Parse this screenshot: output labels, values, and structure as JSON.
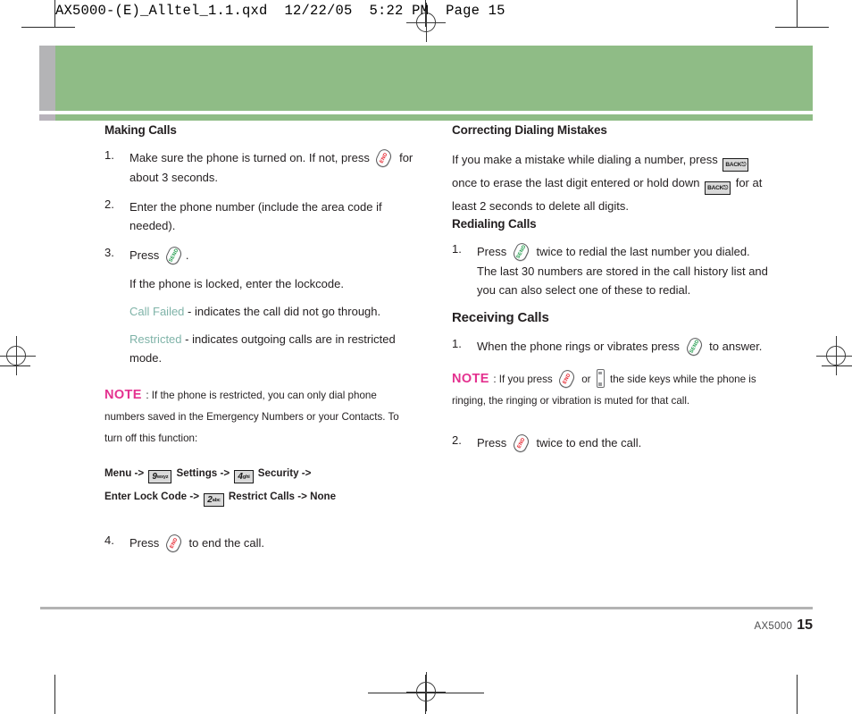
{
  "scan_header": "AX5000-(E)_Alltel_1.1.qxd  12/22/05  5:22 PM  Page 15",
  "colors": {
    "band_green": "#8fbc86",
    "band_gray": "#b4b4b6",
    "note_magenta": "#e4318f",
    "teal_text": "#7fb3a8",
    "send_green": "#1e9c4a",
    "end_red": "#e8202a"
  },
  "left_column": {
    "heading": "Making Calls",
    "steps": [
      {
        "num": "1.",
        "a": "Make sure the phone is turned on. If not, press",
        "b": "for about 3 seconds."
      },
      {
        "num": "2.",
        "a": "Enter the phone number (include the area code if needed)."
      },
      {
        "num": "3.",
        "a": "Press",
        "b": "."
      }
    ],
    "sub_lines": [
      "If the phone is locked, enter the lockcode."
    ],
    "status_lines": [
      {
        "status": "Call Failed",
        "rest": " - indicates the call did not go through."
      },
      {
        "status": "Restricted",
        "rest": " - indicates outgoing calls are in restricted mode."
      }
    ],
    "note": {
      "label": "NOTE",
      "body": ": If the phone is restricted, you can only dial phone numbers saved in the Emergency Numbers or your Contacts. To turn off this function:"
    },
    "menu_path": {
      "line1_a": "Menu ->",
      "key1_digit": "9",
      "key1_letters": "wxyz",
      "line1_b": "Settings ->",
      "key2_digit": "4",
      "key2_letters": "ghi",
      "line1_c": "Security ->",
      "line2_a": "Enter Lock Code ->",
      "key3_digit": "2",
      "key3_letters": "abc",
      "line2_b": "Restrict Calls -> None"
    },
    "final_step": {
      "num": "4.",
      "a": "Press",
      "b": "to end the call."
    }
  },
  "right_column": {
    "heading1": "Correcting Dialing Mistakes",
    "para1_a": "If you make a mistake while dialing a number, press",
    "para1_b": "once to erase the last digit entered or hold down",
    "para1_c": "for at least 2 seconds to delete all digits.",
    "back_key_label": "BACK",
    "heading2": "Redialing Calls",
    "redial_step": {
      "num": "1.",
      "a": "Press",
      "b": "twice to redial the last number you dialed. The last 30 numbers are stored in the call history list and you can also select one of these to redial."
    },
    "heading3": "Receiving Calls",
    "receive_step": {
      "num": "1.",
      "a": "When the phone rings or vibrates press",
      "b": "to answer."
    },
    "note": {
      "label": "NOTE",
      "a": ": If you press",
      "b": "or",
      "c": "the side keys while the phone is ringing, the ringing or vibration is muted for that call."
    },
    "end_step": {
      "num": "2.",
      "a": "Press",
      "b": "twice to end the call."
    }
  },
  "footer": {
    "book": "AX5000",
    "page": "15"
  },
  "key_icons": {
    "send": "SEND",
    "end_line1": "END",
    "end_line2": "END"
  }
}
